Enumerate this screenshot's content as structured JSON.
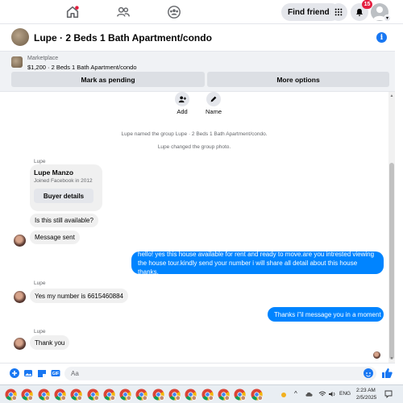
{
  "nav": {
    "find_friends": "Find friends",
    "notification_count": "15"
  },
  "header": {
    "title": "Lupe · 2 Beds 1 Bath Apartment/condo"
  },
  "marketplace": {
    "label": "Marketplace",
    "listing": "$1,200 · 2 Beds 1 Bath Apartment/condo",
    "mark_pending": "Mark as pending",
    "more_options": "More options"
  },
  "actions": {
    "add": "Add",
    "name": "Name"
  },
  "system": {
    "named": "Lupe named the group Lupe · 2 Beds 1 Bath Apartment/condo.",
    "photo": "Lupe changed the group photo."
  },
  "messages": {
    "sender": "Lupe",
    "card_name": "Lupe Manzo",
    "card_sub": "Joined Facebook in 2012",
    "card_button": "Buyer details",
    "m1": "Is this still available?",
    "m2": "Message sent",
    "out1": "hello! yes this house available for rent and ready to move.are you intrested viewing the house tour.kindly send your number i will share all detail about this house thanks.",
    "m3": "Yes my number is 6615460884",
    "out2": "Thanks i\"il message you in a moment",
    "m4": "Thank you"
  },
  "composer": {
    "placeholder": "Aa"
  },
  "taskbar": {
    "lang": "ENG",
    "time": "2:23 AM",
    "date": "2/5/2025"
  },
  "colors": {
    "accent": "#1877f2",
    "outgoing_bubble": "#0084ff",
    "incoming_bubble": "#f0f0f0",
    "badge": "#e41e3f"
  }
}
